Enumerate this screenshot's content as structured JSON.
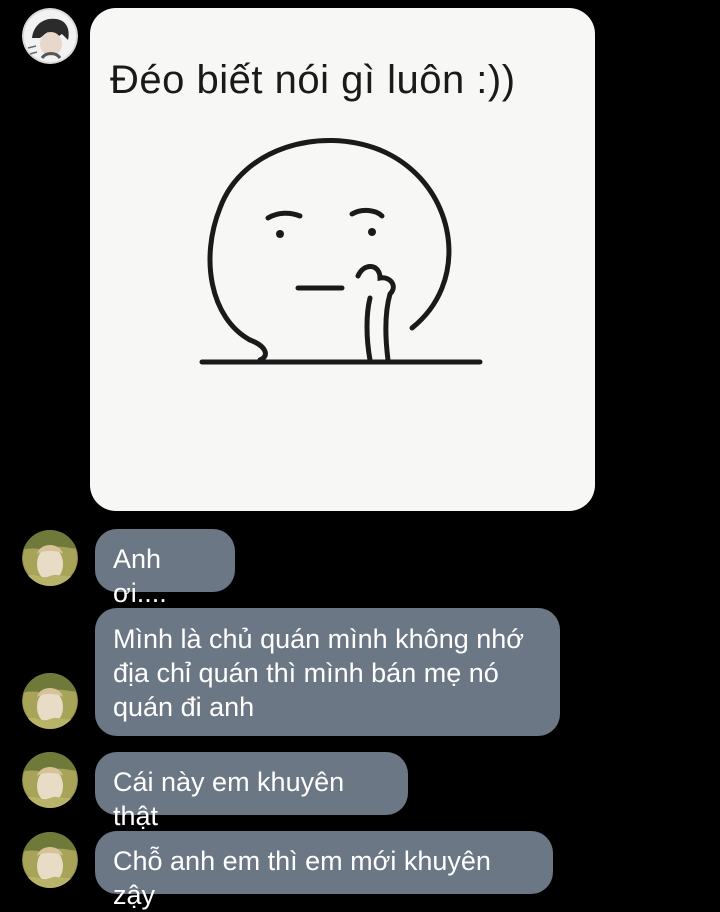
{
  "sticker": {
    "caption": "Đéo biết nói gì luôn :))"
  },
  "messages": [
    {
      "text": "Anh ơi...."
    },
    {
      "text": "Mình là chủ quán mình không nhớ địa chỉ quán thì mình bán mẹ nó quán đi anh"
    },
    {
      "text": "Cái này em khuyên thật"
    },
    {
      "text": "Chỗ anh em thì em mới khuyên zậy"
    }
  ],
  "colors": {
    "background": "#000000",
    "bubble": "#6b7785",
    "bubble_text": "#ffffff",
    "sticker_bg": "#f7f7f5"
  }
}
